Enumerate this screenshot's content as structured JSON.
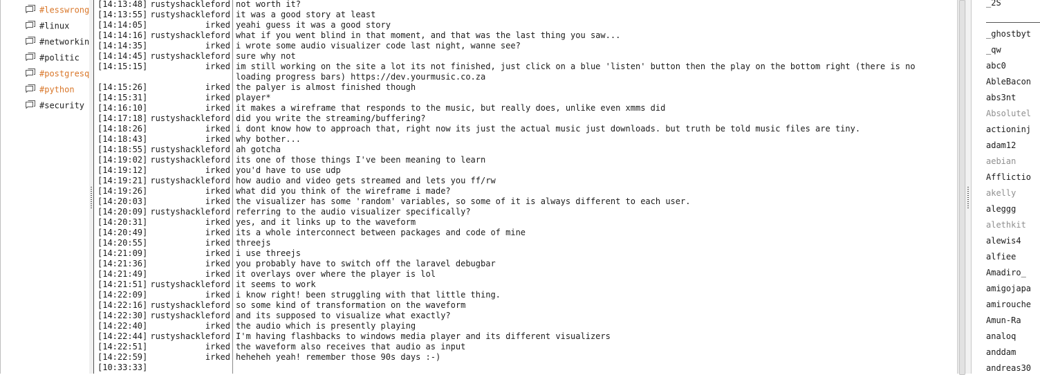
{
  "channels": [
    {
      "name": "#lesswrong",
      "state": "active"
    },
    {
      "name": "#linux",
      "state": "normal"
    },
    {
      "name": "#networking",
      "state": "normal"
    },
    {
      "name": "#politic",
      "state": "normal"
    },
    {
      "name": "#postgresql",
      "state": "active"
    },
    {
      "name": "#python",
      "state": "active"
    },
    {
      "name": "#security",
      "state": "normal"
    }
  ],
  "messages": [
    {
      "time": "[14:13:48]",
      "nick": "rustyshackleford",
      "text": "not worth it?"
    },
    {
      "time": "[14:13:55]",
      "nick": "rustyshackleford",
      "text": "it was a good story at least"
    },
    {
      "time": "[14:14:05]",
      "nick": "irked",
      "text": "yeahi guess it was a good story"
    },
    {
      "time": "[14:14:16]",
      "nick": "rustyshackleford",
      "text": "what if you went blind in that moment, and that was the last thing you saw..."
    },
    {
      "time": "[14:14:35]",
      "nick": "irked",
      "text": "i wrote some audio visualizer code last night, wanne see?"
    },
    {
      "time": "[14:14:45]",
      "nick": "rustyshackleford",
      "text": "sure why not"
    },
    {
      "time": "[14:15:15]",
      "nick": "irked",
      "text": "im still working on the site a lot its not finished, just click on a blue 'listen' button then the play on the bottom right (there is no loading progress bars) https://dev.yourmusic.co.za"
    },
    {
      "time": "[14:15:26]",
      "nick": "irked",
      "text": "the palyer is almost finished though"
    },
    {
      "time": "[14:15:31]",
      "nick": "irked",
      "text": "player*"
    },
    {
      "time": "[14:16:10]",
      "nick": "irked",
      "text": "it makes a wireframe that responds to the music, but really does, unlike even xmms did"
    },
    {
      "time": "[14:17:18]",
      "nick": "rustyshackleford",
      "text": "did you write the streaming/buffering?"
    },
    {
      "time": "[14:18:26]",
      "nick": "irked",
      "text": "i dont know how to approach that, right now its just the actual music just downloads. but truth be told music files are tiny."
    },
    {
      "time": "[14:18:43]",
      "nick": "irked",
      "text": "why bother..."
    },
    {
      "time": "[14:18:55]",
      "nick": "rustyshackleford",
      "text": "ah gotcha"
    },
    {
      "time": "[14:19:02]",
      "nick": "rustyshackleford",
      "text": "its one of those things I've been meaning to learn"
    },
    {
      "time": "[14:19:12]",
      "nick": "irked",
      "text": "you'd have to use udp"
    },
    {
      "time": "[14:19:21]",
      "nick": "rustyshackleford",
      "text": "how audio and video gets streamed and lets you ff/rw"
    },
    {
      "time": "[14:19:26]",
      "nick": "irked",
      "text": "what did you think of the wireframe i made?"
    },
    {
      "time": "[14:20:03]",
      "nick": "irked",
      "text": "the visualizer has some 'random' variables, so some of it is always different to each user."
    },
    {
      "time": "[14:20:09]",
      "nick": "rustyshackleford",
      "text": "referring to the audio visualizer specifically?"
    },
    {
      "time": "[14:20:31]",
      "nick": "irked",
      "text": "yes, and it links up to the waveform"
    },
    {
      "time": "[14:20:49]",
      "nick": "irked",
      "text": "its a whole interconnect between packages and code of mine"
    },
    {
      "time": "[14:20:55]",
      "nick": "irked",
      "text": "threejs"
    },
    {
      "time": "[14:21:09]",
      "nick": "irked",
      "text": "i use threejs"
    },
    {
      "time": "[14:21:36]",
      "nick": "irked",
      "text": "you probably have to switch off the laravel debugbar"
    },
    {
      "time": "[14:21:49]",
      "nick": "irked",
      "text": "it overlays over where the player is lol"
    },
    {
      "time": "[14:21:51]",
      "nick": "rustyshackleford",
      "text": "it seems to work"
    },
    {
      "time": "[14:22:09]",
      "nick": "irked",
      "text": "i know right! been struggling with that little thing."
    },
    {
      "time": "[14:22:16]",
      "nick": "rustyshackleford",
      "text": "so some kind of transformation on the waveform"
    },
    {
      "time": "[14:22:30]",
      "nick": "rustyshackleford",
      "text": "and its supposed to visualize what exactly?"
    },
    {
      "time": "[14:22:40]",
      "nick": "irked",
      "text": "the audio which is presently playing"
    },
    {
      "time": "[14:22:44]",
      "nick": "rustyshackleford",
      "text": "I'm having flashbacks to windows media player and its different visualizers"
    },
    {
      "time": "[14:22:51]",
      "nick": "irked",
      "text": "the waveform also receives that audio as input"
    },
    {
      "time": "[14:22:59]",
      "nick": "irked",
      "text": "heheheh yeah! remember those 90s days :-)"
    },
    {
      "time": "[10:33:33]",
      "nick": "",
      "text": ""
    }
  ],
  "users": [
    {
      "name": "_2S",
      "away": false
    },
    {
      "name": "_ghostbyt",
      "away": false
    },
    {
      "name": "_qw",
      "away": false
    },
    {
      "name": "abc0",
      "away": false
    },
    {
      "name": "AbleBacon",
      "away": false
    },
    {
      "name": "abs3nt",
      "away": false
    },
    {
      "name": "Absolutel",
      "away": true
    },
    {
      "name": "actioninj",
      "away": false
    },
    {
      "name": "adam12",
      "away": false
    },
    {
      "name": "aebian",
      "away": true
    },
    {
      "name": "Afflictio",
      "away": false
    },
    {
      "name": "akelly",
      "away": true
    },
    {
      "name": "aleggg",
      "away": false
    },
    {
      "name": "alethkit",
      "away": true
    },
    {
      "name": "alewis4",
      "away": false
    },
    {
      "name": "alfiee",
      "away": false
    },
    {
      "name": "Amadiro_",
      "away": false
    },
    {
      "name": "amigojapa",
      "away": false
    },
    {
      "name": "amirouche",
      "away": false
    },
    {
      "name": "Amun-Ra",
      "away": false
    },
    {
      "name": "analoq",
      "away": false
    },
    {
      "name": "anddam",
      "away": false
    },
    {
      "name": "andreas30",
      "away": false
    }
  ]
}
